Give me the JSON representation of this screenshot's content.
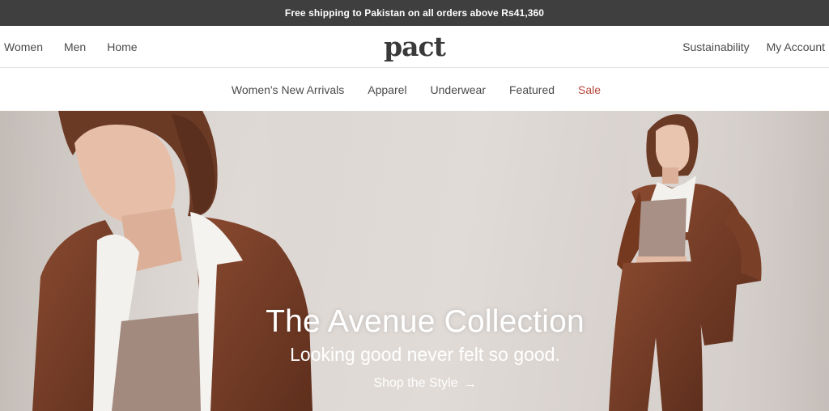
{
  "announcement": {
    "text": "Free shipping to Pakistan on all orders above Rs41,360"
  },
  "header": {
    "left_links": [
      "Women",
      "Men",
      "Home"
    ],
    "logo": "pact",
    "right_links": [
      "Sustainability",
      "My Account"
    ]
  },
  "subnav": {
    "items": [
      "Women's New Arrivals",
      "Apparel",
      "Underwear",
      "Featured",
      "Sale"
    ]
  },
  "hero": {
    "title": "The Avenue Collection",
    "subtitle": "Looking good never felt so good.",
    "cta": "Shop the Style",
    "cta_icon": "arrow-right-icon"
  },
  "colors": {
    "announcement_bg": "#3f3f3f",
    "sale": "#b5463a",
    "hero_bg": "#ddd7d3",
    "jacket": "#7a3f27"
  }
}
